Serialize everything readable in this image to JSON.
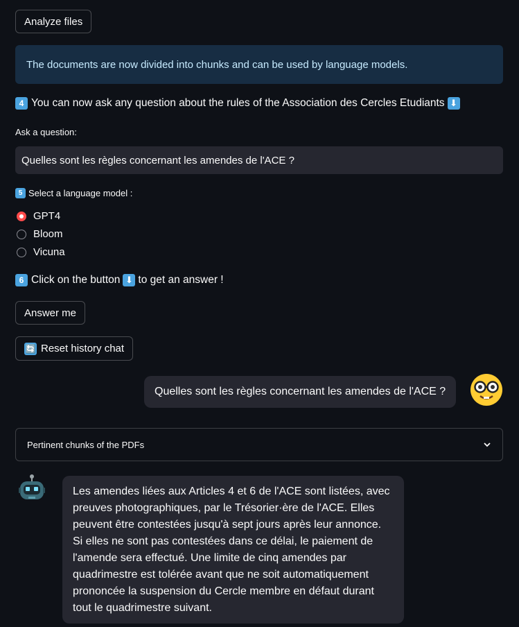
{
  "analyze_button": "Analyze files",
  "info_message": "The documents are now divided into chunks and can be used by language models.",
  "step4": {
    "badge": "4",
    "text": "You can now ask any question about the rules of the Association des Cercles Etudiants",
    "arrow": "⬇"
  },
  "question_label": "Ask a question:",
  "question_value": "Quelles sont les règles concernant les amendes de l'ACE ?",
  "step5": {
    "badge": "5",
    "text": "Select a language model :"
  },
  "models": [
    {
      "label": "GPT4",
      "selected": true
    },
    {
      "label": "Bloom",
      "selected": false
    },
    {
      "label": "Vicuna",
      "selected": false
    }
  ],
  "step6": {
    "badge": "6",
    "text_before": "Click on the button",
    "arrow": "⬇",
    "text_after": "to get an answer !"
  },
  "answer_button": "Answer me",
  "reset_button": {
    "icon": "🔄",
    "label": "Reset history chat"
  },
  "user_message": "Quelles sont les règles concernant les amendes de l'ACE ?",
  "expander_label": "Pertinent chunks of the PDFs",
  "bot_message": "Les amendes liées aux Articles 4 et 6 de l'ACE sont listées, avec preuves photographiques, par le Trésorier·ère de l'ACE. Elles peuvent être contestées jusqu'à sept jours après leur annonce. Si elles ne sont pas contestées dans ce délai, le paiement de l'amende sera effectué. Une limite de cinq amendes par quadrimestre est tolérée avant que ne soit automatiquement prononcée la suspension du Cercle membre en défaut durant tout le quadrimestre suivant.",
  "colors": {
    "background": "#0e1117",
    "info_bg": "#172d43",
    "info_text": "#c7ebff",
    "accent": "#ff4b4b",
    "keycap": "#4aa3df",
    "bubble": "#262730"
  }
}
